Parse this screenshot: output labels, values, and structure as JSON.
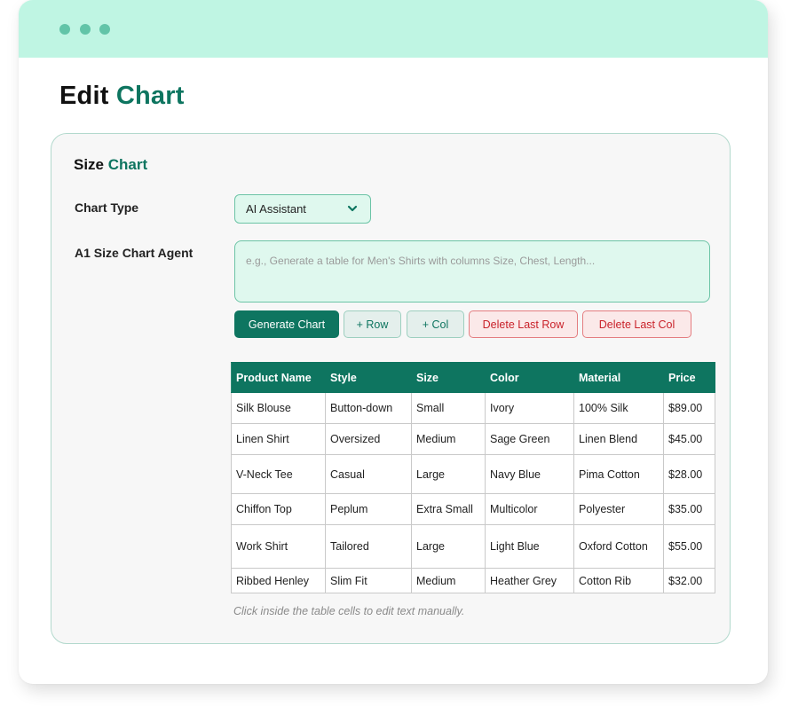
{
  "header": {
    "title_prefix": "Edit",
    "title_accent": "Chart"
  },
  "card": {
    "title_prefix": "Size",
    "title_accent": "Chart"
  },
  "form": {
    "chart_type_label": "Chart Type",
    "chart_type_value": "AI Assistant",
    "agent_label": "A1 Size Chart Agent",
    "prompt_placeholder": "e.g., Generate a table for Men's Shirts with columns Size, Chest, Length...",
    "prompt_value": ""
  },
  "toolbar": {
    "generate_label": "Generate Chart",
    "add_row_label": "+ Row",
    "add_col_label": "+ Col",
    "delete_row_label": "Delete Last Row",
    "delete_col_label": "Delete Last Col"
  },
  "table": {
    "columns": [
      "Product Name",
      "Style",
      "Size",
      "Color",
      "Material",
      "Price"
    ],
    "rows": [
      [
        "Silk Blouse",
        "Button-down",
        "Small",
        "Ivory",
        "100% Silk",
        "$89.00"
      ],
      [
        "Linen Shirt",
        "Oversized",
        "Medium",
        "Sage Green",
        "Linen Blend",
        "$45.00"
      ],
      [
        "V-Neck Tee",
        "Casual",
        "Large",
        "Navy Blue",
        "Pima Cotton",
        "$28.00"
      ],
      [
        "Chiffon Top",
        "Peplum",
        "Extra Small",
        "Multicolor",
        "Polyester",
        "$35.00"
      ],
      [
        "Work Shirt",
        "Tailored",
        "Large",
        "Light Blue",
        "Oxford Cotton",
        "$55.00"
      ],
      [
        "Ribbed Henley",
        "Slim Fit",
        "Medium",
        "Heather Grey",
        "Cotton Rib",
        "$32.00"
      ]
    ]
  },
  "hint": "Click inside the table cells to edit text manually.",
  "icons": {
    "window_controls": [
      "dot-icon",
      "dot-icon",
      "dot-icon"
    ],
    "select_arrow": "chevron-down-icon"
  },
  "colors": {
    "accent": "#0e7560",
    "titlebar": "#bff5e3",
    "field_bg": "#dff8ee",
    "danger": "#c9222a"
  }
}
